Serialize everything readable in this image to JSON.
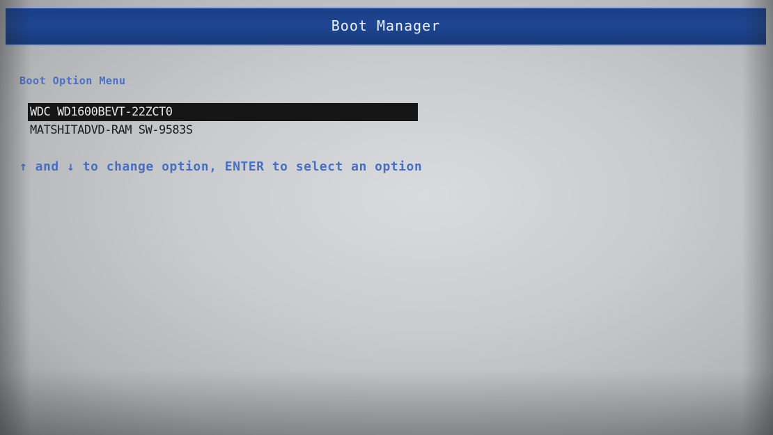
{
  "header": {
    "title": "Boot Manager"
  },
  "menu": {
    "label": "Boot Option Menu",
    "options": [
      {
        "label": "WDC WD1600BEVT-22ZCT0",
        "selected": true
      },
      {
        "label": "MATSHITADVD-RAM SW-9583S",
        "selected": false
      }
    ],
    "hint": "↑ and ↓ to change option, ENTER to select an option"
  },
  "colors": {
    "title_bar": "#1e4691",
    "accent_text": "#4a6fc2",
    "selection": "#161616",
    "background": "#c9cbce"
  }
}
